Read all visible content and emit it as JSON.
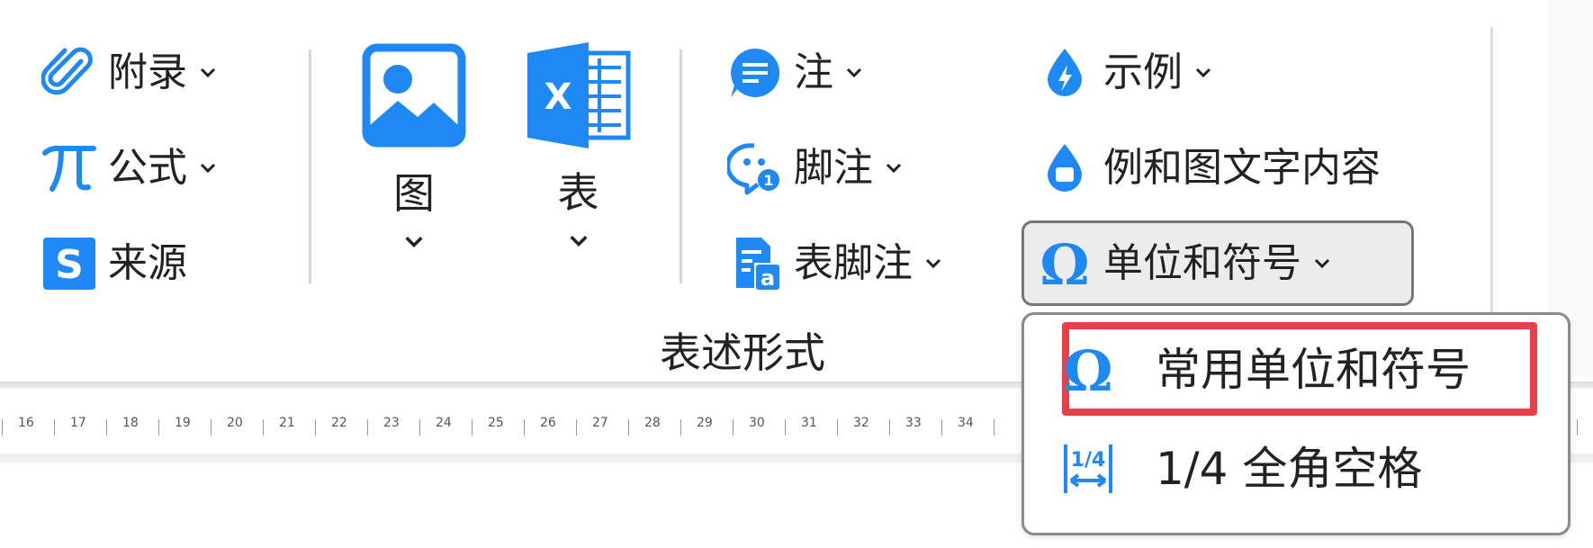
{
  "ribbon": {
    "col1": [
      {
        "label": "附录",
        "icon": "paperclip-icon",
        "has_dropdown": true
      },
      {
        "label": "公式",
        "icon": "pi-icon",
        "has_dropdown": true
      },
      {
        "label": "来源",
        "icon": "s-source-icon",
        "has_dropdown": false
      }
    ],
    "image_button": {
      "label": "图",
      "icon": "image-icon"
    },
    "table_button": {
      "label": "表",
      "icon": "excel-icon"
    },
    "col3": [
      {
        "label": "注",
        "icon": "note-icon",
        "has_dropdown": true
      },
      {
        "label": "脚注",
        "icon": "footnote-icon",
        "has_dropdown": true
      },
      {
        "label": "表脚注",
        "icon": "table-footnote-icon",
        "has_dropdown": true
      }
    ],
    "col4": [
      {
        "label": "示例",
        "icon": "drop-lightning-icon",
        "has_dropdown": true
      },
      {
        "label": "例和图文字内容",
        "icon": "drop-square-icon",
        "has_dropdown": false
      },
      {
        "label": "单位和符号",
        "icon": "omega-icon",
        "has_dropdown": true
      }
    ],
    "group_label": "表述形式"
  },
  "ruler": {
    "ticks": [
      "16",
      "17",
      "18",
      "19",
      "20",
      "21",
      "22",
      "23",
      "24",
      "25",
      "26",
      "27",
      "28",
      "29",
      "30",
      "31",
      "32",
      "33",
      "34"
    ]
  },
  "dropdown_menu": {
    "items": [
      {
        "label": "常用单位和符号",
        "icon": "omega-icon"
      },
      {
        "label": "1/4 全角空格",
        "icon": "quarter-space-icon"
      }
    ]
  },
  "colors": {
    "accent": "#1E88F5",
    "highlight": "#E8404A"
  }
}
